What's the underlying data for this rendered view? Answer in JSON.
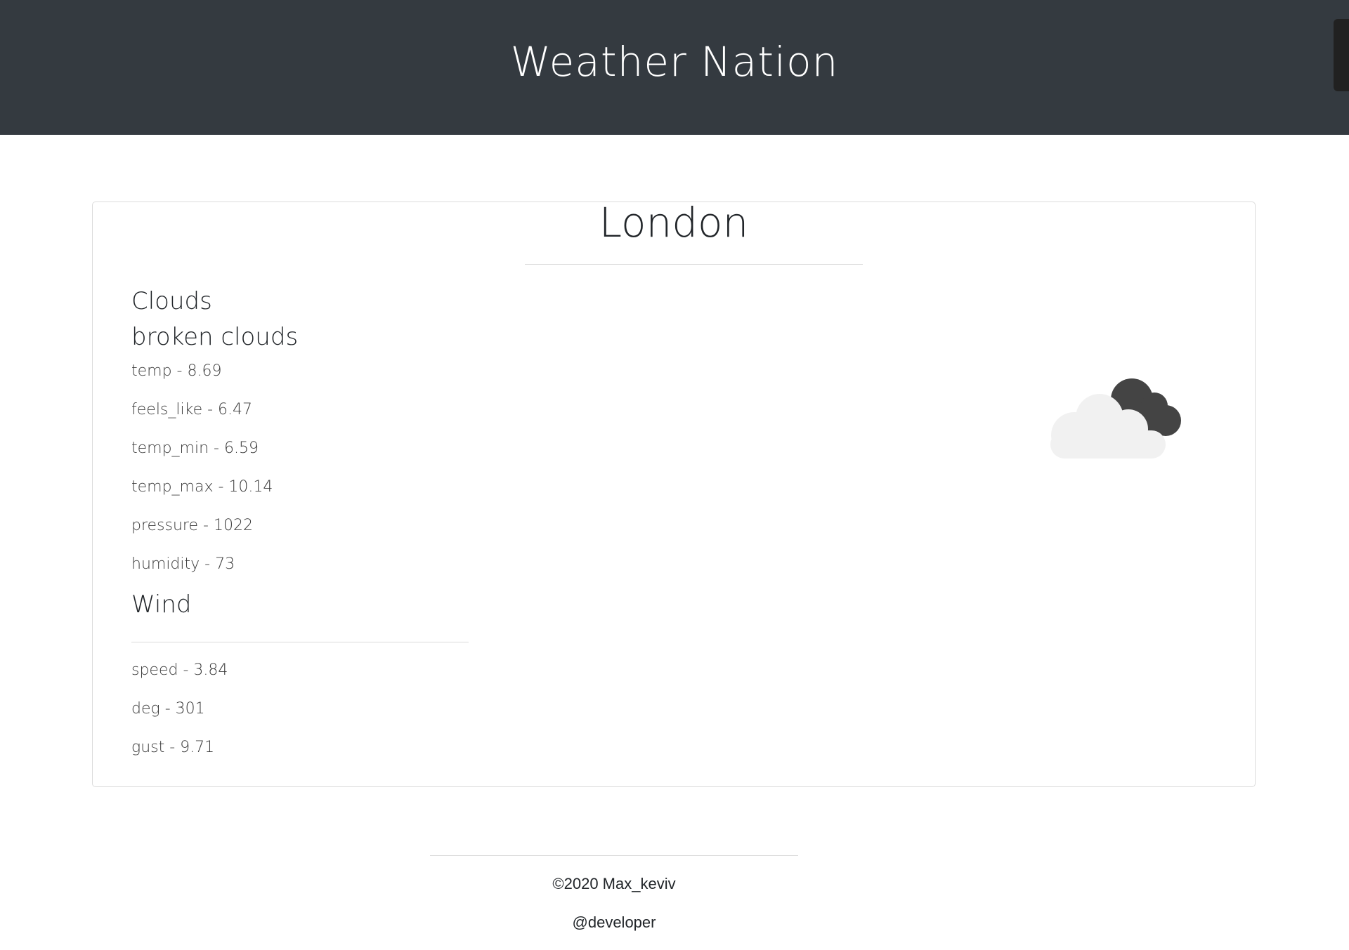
{
  "header": {
    "title": "Weather Nation"
  },
  "city": {
    "name": "London"
  },
  "weather": {
    "main": "Clouds",
    "description": "broken clouds",
    "icon": "broken-clouds-icon",
    "stats": [
      {
        "label": "temp - 8.69"
      },
      {
        "label": "feels_like - 6.47"
      },
      {
        "label": "temp_min - 6.59"
      },
      {
        "label": "temp_max - 10.14"
      },
      {
        "label": "pressure - 1022"
      },
      {
        "label": "humidity - 73"
      }
    ]
  },
  "wind": {
    "title": "Wind",
    "stats": [
      {
        "label": "speed - 3.84"
      },
      {
        "label": "deg - 301"
      },
      {
        "label": "gust - 9.71"
      }
    ]
  },
  "footer": {
    "copyright": "©2020 Max_keviv",
    "handle": "@developer"
  },
  "colors": {
    "header_bg": "#343a40",
    "header_text": "#ffffff",
    "cloud_light": "#f1f1f1",
    "cloud_dark": "#444444"
  }
}
